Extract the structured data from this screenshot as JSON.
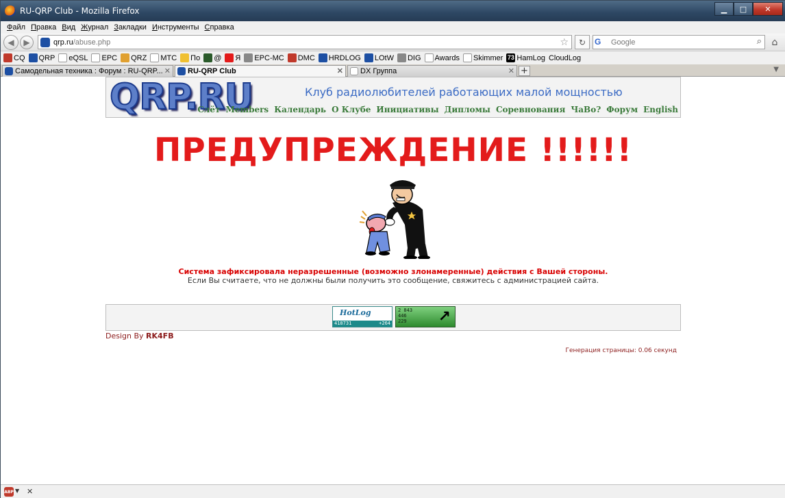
{
  "window": {
    "title": "RU-QRP Club - Mozilla Firefox",
    "controls": {
      "minimize": "▁",
      "maximize": "□",
      "close": "✕"
    }
  },
  "menu": [
    "Файл",
    "Правка",
    "Вид",
    "Журнал",
    "Закладки",
    "Инструменты",
    "Справка"
  ],
  "nav": {
    "url_host": "qrp.ru",
    "url_path": "/abuse.php",
    "search_placeholder": "Google",
    "search_engine": "G"
  },
  "bookmarks": [
    {
      "label": "CQ",
      "icon": "cq-icon",
      "color": "#c0392b"
    },
    {
      "label": "QRP",
      "icon": "qrp-icon",
      "color": "#1d4fa3"
    },
    {
      "label": "eQSL",
      "icon": "page-icon",
      "color": "#ffffff"
    },
    {
      "label": "EPC",
      "icon": "wave-icon",
      "color": "#ffffff"
    },
    {
      "label": "QRZ",
      "icon": "people-icon",
      "color": "#e0a030"
    },
    {
      "label": "MTC",
      "icon": "page-icon",
      "color": "#ffffff"
    },
    {
      "label": "По",
      "icon": "weather-icon",
      "color": "#f0c030"
    },
    {
      "label": "@",
      "icon": "mail-icon",
      "color": "#2a5a2a"
    },
    {
      "label": "Я",
      "icon": "yandex-icon",
      "color": "#e31b1b"
    },
    {
      "label": "EPC-MC",
      "icon": "gear-icon",
      "color": "#888888"
    },
    {
      "label": "DMC",
      "icon": "dmc-icon",
      "color": "#c0392b"
    },
    {
      "label": "HRDLOG",
      "icon": "globe-icon",
      "color": "#1d4fa3"
    },
    {
      "label": "LOtW",
      "icon": "lotw-icon",
      "color": "#1d4fa3"
    },
    {
      "label": "DIG",
      "icon": "antenna-icon",
      "color": "#888888"
    },
    {
      "label": "Awards",
      "icon": "page-icon",
      "color": "#ffffff"
    },
    {
      "label": "Skimmer",
      "icon": "page-icon",
      "color": "#ffffff"
    },
    {
      "label": "HamLog",
      "icon": "hamlog-icon",
      "color": "#000000",
      "icon_text": "73"
    },
    {
      "label": "CloudLog",
      "icon": "",
      "color": ""
    }
  ],
  "tabs": [
    {
      "label": "Самодельная техника : Форум : RU-QRP...",
      "active": false
    },
    {
      "label": "RU-QRP Club",
      "active": true
    },
    {
      "label": "DX Группа",
      "active": false
    }
  ],
  "site": {
    "logo": "QRP.RU",
    "slogan": "Клуб радиолюбителей работающих малой мощностью",
    "nav": [
      "Слёт",
      "Members",
      "Календарь",
      "О Клубе",
      "Инициативы",
      "Дипломы",
      "Соревнования",
      "ЧаВо?",
      "Форум",
      "English"
    ]
  },
  "page": {
    "warning_title": "ПРЕДУПРЕЖДЕНИЕ !!!!!!",
    "message_main": "Система зафиксировала неразрешенные (возможно злонамеренные) действия с Вашей стороны.",
    "message_sub": "Если Вы считаете, что не должны были получить это сообщение, свяжитесь с администрацией сайта."
  },
  "counters": {
    "hotlog_title": "HotLog",
    "hotlog_total": "418731",
    "hotlog_delta": "+264",
    "li_lines": [
      "2 843",
      "446",
      "229"
    ],
    "li_arrow": "↗"
  },
  "footer": {
    "design_prefix": "Design By ",
    "design_author": "RK4FB",
    "generation": "Генерация страницы: 0.06 секунд"
  },
  "statusbar": {
    "addon_label": "ABP",
    "dropdown": "▼",
    "close": "✕"
  },
  "colors": {
    "warning": "#e31b1b",
    "message": "#d80000",
    "nav_link": "#3a7a3a",
    "slogan": "#3b6bc4",
    "footer_text": "#8b1a1a"
  }
}
